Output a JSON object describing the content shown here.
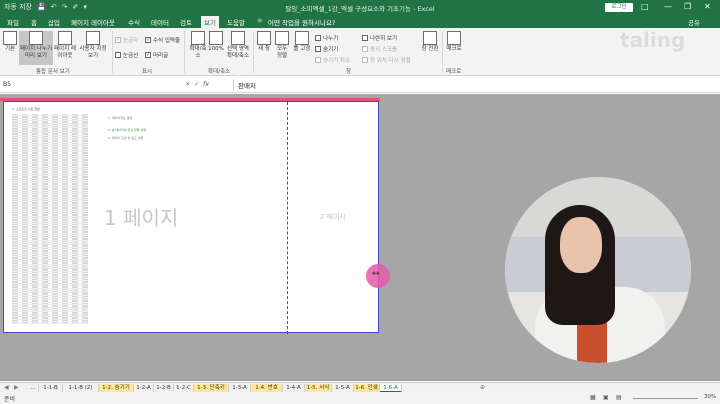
{
  "titlebar": {
    "autosave": "자동 저장",
    "title": "탈잉_소피엑셀_1강_엑셀 구성요소와 기초기능 - Excel",
    "login": "로그인"
  },
  "tabs": [
    "파일",
    "홈",
    "삽입",
    "페이지 레이아웃",
    "수식",
    "데이터",
    "검토",
    "보기",
    "도움말",
    "어떤 작업을 원하시나요?"
  ],
  "active_tab": "보기",
  "share": "공유",
  "ribbon": {
    "workbook_views": {
      "label": "통합 문서 보기",
      "items": [
        "기본",
        "페이지 나누기 미리 보기",
        "페이지 레이아웃",
        "사용자 지정 보기"
      ]
    },
    "show": {
      "label": "표시",
      "checks": [
        {
          "text": "눈금자",
          "checked": true,
          "dim": true
        },
        {
          "text": "수식 입력줄",
          "checked": true,
          "dim": false
        },
        {
          "text": "눈금선",
          "checked": false,
          "dim": false
        },
        {
          "text": "머리글",
          "checked": true,
          "dim": false
        }
      ]
    },
    "zoom": {
      "label": "확대/축소",
      "items": [
        "확대/축소",
        "100%",
        "선택 영역 확대/축소"
      ]
    },
    "window": {
      "label": "창",
      "items": [
        "새 창",
        "모두 정렬",
        "틀 고정"
      ],
      "checks": [
        "나누기",
        "숨기기",
        "숨기기 취소"
      ],
      "side": [
        "나란히 보기",
        "동시 스크롤",
        "창 위치 다시 정렬"
      ],
      "switch": "창 전환"
    },
    "macro": {
      "label": "매크로",
      "item": "매크로"
    }
  },
  "brand": "taling",
  "formula_bar": {
    "name_box": "B5",
    "fx": "fx",
    "value": "판매처"
  },
  "sheet": {
    "page1_label": "1 페이지",
    "page2_label": "2 페이지",
    "mini_title": "1. 소프트인 시트 현황",
    "notes": [
      "1. 데이터개요 설명",
      "2. 본 데이터의 주요 항목 설명",
      "3. 데이터 구성 및 필드 설명"
    ]
  },
  "sheet_tabs": [
    {
      "label": "...",
      "style": "n"
    },
    {
      "label": "1-1-B",
      "style": "n"
    },
    {
      "label": "1-1-B (2)",
      "style": "n"
    },
    {
      "label": "1-2. 숨기기",
      "style": "y"
    },
    {
      "label": "1-2-A",
      "style": "n"
    },
    {
      "label": "1-2-B",
      "style": "n"
    },
    {
      "label": "1-2-C",
      "style": "n"
    },
    {
      "label": "1-3. 단축키",
      "style": "y"
    },
    {
      "label": "1-3-A",
      "style": "n"
    },
    {
      "label": "1-4. 번호",
      "style": "y"
    },
    {
      "label": "1-4-A",
      "style": "n"
    },
    {
      "label": "1-5. 서식",
      "style": "y"
    },
    {
      "label": "1-5-A",
      "style": "n"
    },
    {
      "label": "1-6. 인쇄",
      "style": "y"
    },
    {
      "label": "1-6-A",
      "style": "active"
    }
  ],
  "status": {
    "ready": "준비",
    "zoom": "30%"
  }
}
